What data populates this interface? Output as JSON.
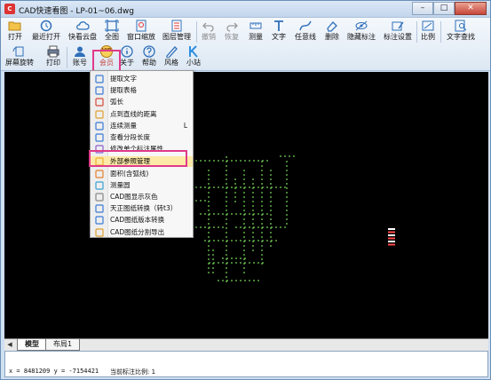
{
  "window": {
    "title": "CAD快速看图 - LP-01~06.dwg",
    "controls": {
      "minimize": "–",
      "maximize": "□",
      "close": "✕"
    }
  },
  "toolbar": {
    "row1": [
      {
        "label": "打开",
        "icon": "folder-open-icon",
        "disabled": false
      },
      {
        "label": "最近打开",
        "icon": "history-icon",
        "disabled": false
      },
      {
        "label": "快看云盘",
        "icon": "cloud-icon",
        "disabled": false
      },
      {
        "label": "全图",
        "icon": "fit-all-icon",
        "disabled": false
      },
      {
        "label": "窗口缩放",
        "icon": "zoom-window-icon",
        "disabled": false
      },
      {
        "label": "图层管理",
        "icon": "layers-icon",
        "disabled": false
      },
      {
        "label": "撤销",
        "icon": "undo-icon",
        "disabled": true
      },
      {
        "label": "恢复",
        "icon": "redo-icon",
        "disabled": true
      },
      {
        "label": "测量",
        "icon": "measure-icon",
        "disabled": false
      },
      {
        "label": "文字",
        "icon": "text-icon",
        "disabled": false
      },
      {
        "label": "任意线",
        "icon": "freeline-icon",
        "disabled": false
      },
      {
        "label": "删除",
        "icon": "erase-icon",
        "disabled": false
      },
      {
        "label": "隐藏标注",
        "icon": "hide-annotation-icon",
        "disabled": false
      },
      {
        "label": "标注设置",
        "icon": "annotation-settings-icon",
        "disabled": false
      },
      {
        "label": "比例",
        "icon": "scale-icon",
        "disabled": false
      },
      {
        "label": "文字查找",
        "icon": "text-search-icon",
        "disabled": false
      }
    ],
    "row2": [
      {
        "label": "屏幕旋转",
        "icon": "rotate-screen-icon"
      },
      {
        "label": "打印",
        "icon": "printer-icon"
      },
      {
        "label": "账号",
        "icon": "user-icon"
      },
      {
        "label": "会员",
        "icon": "vip-icon",
        "badge": "VIP"
      },
      {
        "label": "关于",
        "icon": "info-icon"
      },
      {
        "label": "帮助",
        "icon": "help-icon"
      },
      {
        "label": "风格",
        "icon": "style-icon"
      },
      {
        "label": "小站",
        "icon": "kuaikan-icon"
      }
    ]
  },
  "menu": {
    "items": [
      {
        "label": "提取文字",
        "icon": "extract-text-icon",
        "shortcut": ""
      },
      {
        "label": "提取表格",
        "icon": "extract-table-icon",
        "shortcut": ""
      },
      {
        "label": "弧长",
        "icon": "arc-length-icon",
        "shortcut": ""
      },
      {
        "label": "点到直线的距离",
        "icon": "point-line-distance-icon",
        "shortcut": ""
      },
      {
        "label": "连续测量",
        "icon": "continuous-measure-icon",
        "shortcut": "L"
      },
      {
        "label": "查看分段长度",
        "icon": "segment-length-icon",
        "shortcut": ""
      },
      {
        "label": "修改单个标注属性",
        "icon": "edit-annotation-icon",
        "shortcut": ""
      },
      {
        "label": "外部参照管理",
        "icon": "xref-icon",
        "shortcut": "",
        "highlighted": true
      },
      {
        "label": "面积(含弧线)",
        "icon": "area-icon",
        "shortcut": ""
      },
      {
        "label": "测量圆",
        "icon": "measure-circle-icon",
        "shortcut": ""
      },
      {
        "label": "CAD图显示灰色",
        "icon": "gray-display-icon",
        "shortcut": ""
      },
      {
        "label": "天正图纸转换（转t3）",
        "icon": "tangent-convert-icon",
        "shortcut": ""
      },
      {
        "label": "CAD图纸版本转换",
        "icon": "version-convert-icon",
        "shortcut": ""
      },
      {
        "label": "CAD图纸分割导出",
        "icon": "split-export-icon",
        "shortcut": ""
      }
    ]
  },
  "tabs": {
    "nav_icons": [
      "triangle-left-icon"
    ],
    "items": [
      {
        "label": "模型",
        "active": true
      },
      {
        "label": "布局1",
        "active": false
      }
    ]
  },
  "status": {
    "coords": "x = 8481209  y = -7154421",
    "ratio": "当前标注比例: 1"
  },
  "colors": {
    "accent_highlight": "#e03a8a",
    "canvas_bg": "#000000",
    "drawing_lines": "#8cff6a",
    "menu_highlight": "#fde9a8"
  }
}
